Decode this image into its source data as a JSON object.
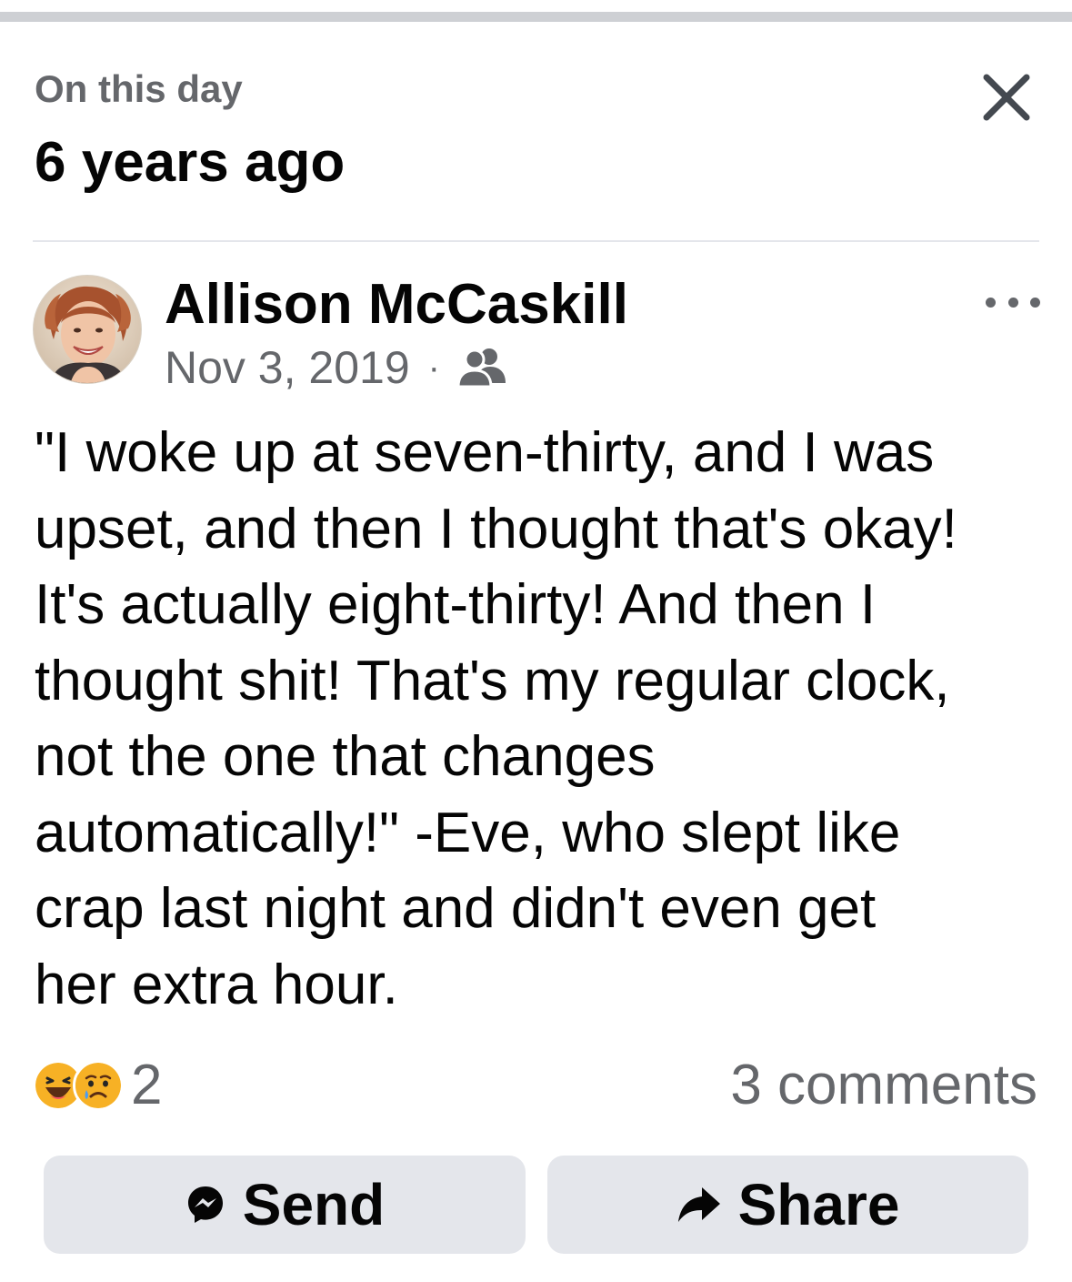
{
  "memory_header": {
    "subtitle": "On this day",
    "title": "6 years ago"
  },
  "post": {
    "author": "Allison McCaskill",
    "date": "Nov 3, 2019",
    "separator": "·",
    "audience_icon": "friends-icon",
    "text": "\"I woke up at seven-thirty, and I was\nupset, and then I thought that's okay!\nIt's actually eight-thirty! And then I\nthought shit! That's my regular clock,\nnot the one that changes\nautomatically!\" -Eve, who slept like\ncrap last night and didn't even get\nher extra hour."
  },
  "engagement": {
    "reaction_icons": [
      "haha-icon",
      "sad-icon"
    ],
    "reaction_count": "2",
    "comments": "3 comments"
  },
  "actions": {
    "send_label": "Send",
    "share_label": "Share"
  },
  "colors": {
    "primary_text": "#050505",
    "secondary_text": "#65676b",
    "button_bg": "#e4e6eb",
    "divider": "#e4e6eb"
  }
}
